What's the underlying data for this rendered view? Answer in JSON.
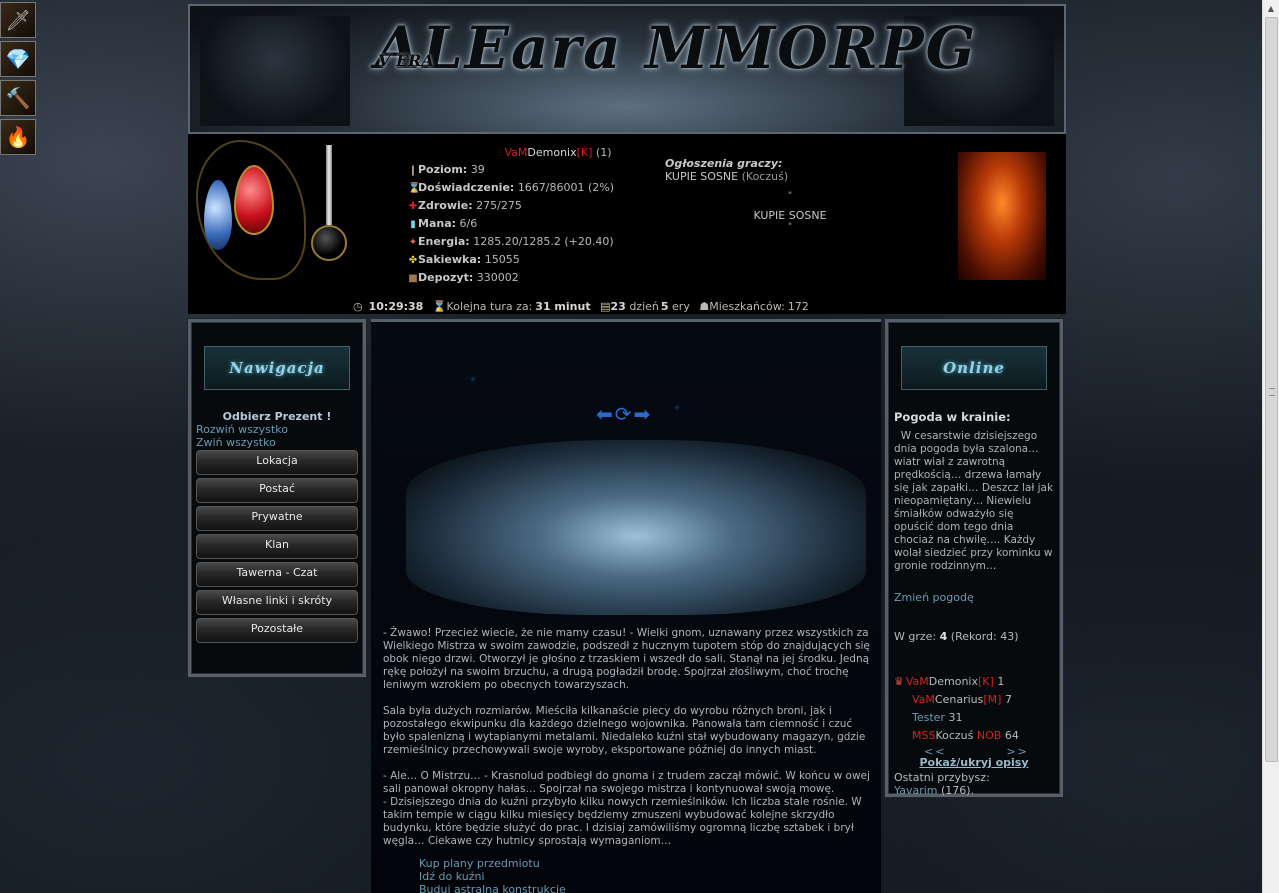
{
  "banner": {
    "logo": "ALEara MMORPG",
    "logo_sub": "V ERA"
  },
  "player": {
    "prefix": "VaM",
    "name": "Demonix",
    "tag": "[K]",
    "count": "(1)",
    "stats": [
      {
        "label": "Poziom:",
        "value": "39",
        "icon": "level-icon"
      },
      {
        "label": "Doświadczenie:",
        "value": "1667/86001 (2%)",
        "icon": "experience-icon"
      },
      {
        "label": "Zdrowie:",
        "value": "275/275",
        "icon": "health-icon"
      },
      {
        "label": "Mana:",
        "value": "6/6",
        "icon": "mana-icon"
      },
      {
        "label": "Energia:",
        "value": "1285.20/1285.2 (+20.40)",
        "icon": "energy-icon"
      },
      {
        "label": "Sakiewka:",
        "value": "15055",
        "icon": "purse-icon"
      },
      {
        "label": "Depozyt:",
        "value": "330002",
        "icon": "deposit-icon"
      }
    ]
  },
  "announcements": {
    "title": "Ogłoszenia graczy:",
    "line1_text": "KUPIE SOSNE",
    "line1_author": "(Koczuś)",
    "sep1": "\"",
    "body": "KUPIE SOSNE",
    "sep2": "\""
  },
  "timebar": {
    "time": "10:29:38",
    "next_turn_label": "Kolejna tura za:",
    "next_turn_value": "31 minut",
    "day_num": "23",
    "day_label": "dzień",
    "era_num": "5",
    "era_label": "ery",
    "residents_label": "Mieszkańców:",
    "residents_value": "172"
  },
  "nav": {
    "title": "Nawigacja",
    "gift": "Odbierz Prezent !",
    "expand_all": "Rozwiń wszystko",
    "collapse_all": "Zwiń wszystko",
    "buttons": [
      "Lokacja",
      "Postać",
      "Prywatne",
      "Klan",
      "Tawerna - Czat",
      "Własne linki i skróty",
      "Pozostałe"
    ]
  },
  "story": {
    "p1": "- Żwawo! Przecież wiecie, że nie mamy czasu! - Wielki gnom, uznawany przez wszystkich za Wielkiego Mistrza w swoim zawodzie, podszedł z hucznym tupotem stóp do znajdujących się obok niego drzwi. Otworzył je głośno z trzaskiem i wszedł do sali. Stanął na jej środku. Jedną rękę położył na swoim brzuchu, a drugą pogładził brodę. Spojrzał złośliwym, choć trochę leniwym wzrokiem po obecnych towarzyszach.",
    "p2": "Sala była dużych rozmiarów. Mieściła kilkanaście piecy do wyrobu różnych broni, jak i pozostałego ekwipunku dla każdego dzielnego wojownika. Panowała tam ciemność i czuć było spalenizną i wytapianymi metalami. Niedaleko kuźni stał wybudowany magazyn, gdzie rzemieślnicy przechowywali swoje wyroby, eksportowane później do innych miast.",
    "p3": "- Ale… O Mistrzu… - Krasnolud podbiegł do gnoma i z trudem zaczął mówić. W końcu w owej sali panował okropny hałas… Spojrzał na swojego mistrza i kontynuował swoją mowę.",
    "p4": "- Dzisiejszego dnia do kuźni przybyło kilku nowych rzemieślników. Ich liczba stale rośnie. W takim tempie w ciągu kilku miesięcy będziemy zmuszeni wybudować kolejne skrzydło budynku, które będzie służyć do prac. I dzisiaj zamówiliśmy ogromną liczbę sztabek i brył węgla… Ciekawe czy hutnicy sprostają wymaganiom…"
  },
  "actions": [
    "Kup plany przedmiotu",
    "Idź do kuźni",
    "Buduj astralną konstrukcję"
  ],
  "online": {
    "title": "Online",
    "weather_title": "Pogoda w krainie:",
    "weather_text": "W cesarstwie dzisiejszego dnia pogoda była szalona… wiatr wiał z zawrotną prędkością… drzewa łamały się jak zapałki… Deszcz lał jak nieopamiętany… Niewielu śmiałków odważyło się opuścić dom tego dnia chociaż na chwilę…. Każdy wolał siedzieć przy kominku w gronie rodzinnym…",
    "change_weather": "Zmień pogodę",
    "ingame_label": "W grze:",
    "ingame_count": "4",
    "ingame_record": "(Rekord: 43)",
    "players": [
      {
        "prefix": "VaM",
        "name": "Demonix",
        "tag": "[K]",
        "level": "1"
      },
      {
        "prefix": "VaM",
        "name": "Cenarius",
        "tag": "[M]",
        "level": "7"
      },
      {
        "prefix": "",
        "name": "Tester",
        "tag": "",
        "level": "31"
      },
      {
        "prefix": "MSS",
        "name": "Koczuś",
        "tag": "NOB",
        "level": "64"
      }
    ],
    "prev": "<<",
    "next": ">>",
    "toggle": "Pokaż/ukryj opisy",
    "last_label": "Ostatni przybysz:",
    "last_name": "Yavarim",
    "last_num": "(176)."
  },
  "colors": {
    "accent_red": "#d42020",
    "link_blue": "#6a9ab0",
    "panel_border": "#55606a"
  }
}
